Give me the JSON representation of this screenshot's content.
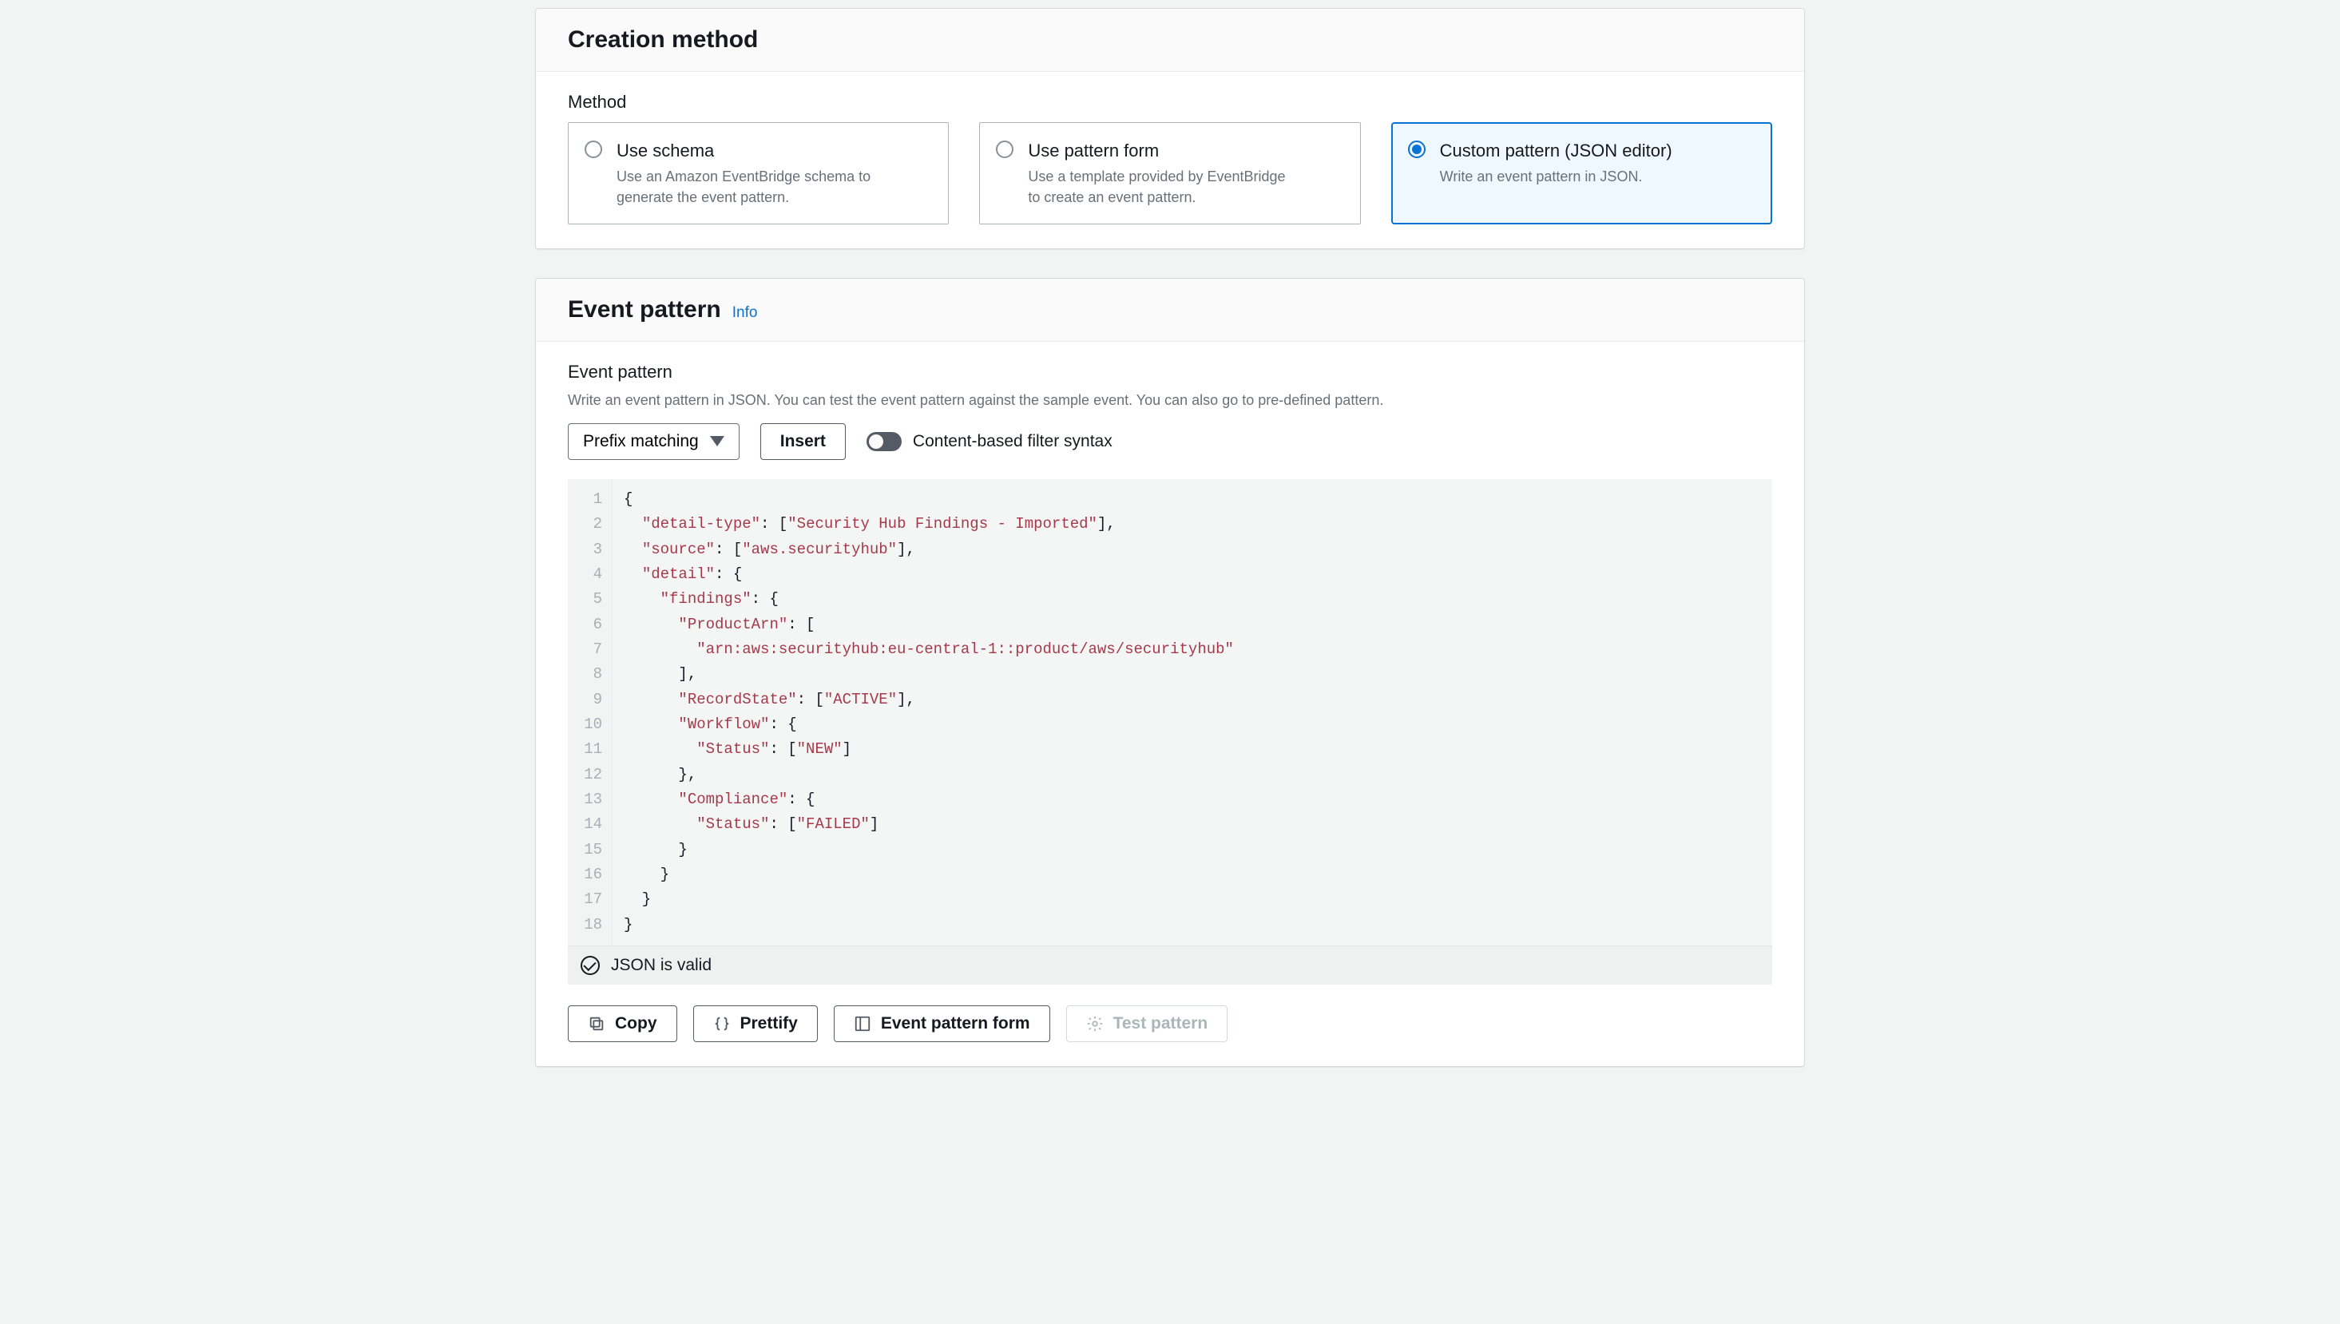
{
  "creation": {
    "title": "Creation method",
    "method_label": "Method",
    "options": [
      {
        "title": "Use schema",
        "desc": "Use an Amazon EventBridge schema to generate the event pattern."
      },
      {
        "title": "Use pattern form",
        "desc": "Use a template provided by EventBridge to create an event pattern."
      },
      {
        "title": "Custom pattern (JSON editor)",
        "desc": "Write an event pattern in JSON."
      }
    ]
  },
  "event_pattern": {
    "title": "Event pattern",
    "info": "Info",
    "label": "Event pattern",
    "desc": "Write an event pattern in JSON. You can test the event pattern against the sample event. You can also go to pre-defined pattern.",
    "select_value": "Prefix matching",
    "insert_label": "Insert",
    "toggle_label": "Content-based filter syntax",
    "status_text": "JSON is valid",
    "buttons": {
      "copy": "Copy",
      "prettify": "Prettify",
      "form": "Event pattern form",
      "test": "Test pattern"
    },
    "code_lines": [
      [
        {
          "t": "p",
          "v": "{"
        }
      ],
      [
        {
          "t": "p",
          "v": "  "
        },
        {
          "t": "k",
          "v": "\"detail-type\""
        },
        {
          "t": "p",
          "v": ": ["
        },
        {
          "t": "s",
          "v": "\"Security Hub Findings - Imported\""
        },
        {
          "t": "p",
          "v": "],"
        }
      ],
      [
        {
          "t": "p",
          "v": "  "
        },
        {
          "t": "k",
          "v": "\"source\""
        },
        {
          "t": "p",
          "v": ": ["
        },
        {
          "t": "s",
          "v": "\"aws.securityhub\""
        },
        {
          "t": "p",
          "v": "],"
        }
      ],
      [
        {
          "t": "p",
          "v": "  "
        },
        {
          "t": "k",
          "v": "\"detail\""
        },
        {
          "t": "p",
          "v": ": {"
        }
      ],
      [
        {
          "t": "p",
          "v": "    "
        },
        {
          "t": "k",
          "v": "\"findings\""
        },
        {
          "t": "p",
          "v": ": {"
        }
      ],
      [
        {
          "t": "p",
          "v": "      "
        },
        {
          "t": "k",
          "v": "\"ProductArn\""
        },
        {
          "t": "p",
          "v": ": ["
        }
      ],
      [
        {
          "t": "p",
          "v": "        "
        },
        {
          "t": "s",
          "v": "\"arn:aws:securityhub:eu-central-1::product/aws/securityhub\""
        }
      ],
      [
        {
          "t": "p",
          "v": "      ],"
        }
      ],
      [
        {
          "t": "p",
          "v": "      "
        },
        {
          "t": "k",
          "v": "\"RecordState\""
        },
        {
          "t": "p",
          "v": ": ["
        },
        {
          "t": "s",
          "v": "\"ACTIVE\""
        },
        {
          "t": "p",
          "v": "],"
        }
      ],
      [
        {
          "t": "p",
          "v": "      "
        },
        {
          "t": "k",
          "v": "\"Workflow\""
        },
        {
          "t": "p",
          "v": ": {"
        }
      ],
      [
        {
          "t": "p",
          "v": "        "
        },
        {
          "t": "k",
          "v": "\"Status\""
        },
        {
          "t": "p",
          "v": ": ["
        },
        {
          "t": "s",
          "v": "\"NEW\""
        },
        {
          "t": "p",
          "v": "]"
        }
      ],
      [
        {
          "t": "p",
          "v": "      },"
        }
      ],
      [
        {
          "t": "p",
          "v": "      "
        },
        {
          "t": "k",
          "v": "\"Compliance\""
        },
        {
          "t": "p",
          "v": ": {"
        }
      ],
      [
        {
          "t": "p",
          "v": "        "
        },
        {
          "t": "k",
          "v": "\"Status\""
        },
        {
          "t": "p",
          "v": ": ["
        },
        {
          "t": "s",
          "v": "\"FAILED\""
        },
        {
          "t": "p",
          "v": "]"
        }
      ],
      [
        {
          "t": "p",
          "v": "      }"
        }
      ],
      [
        {
          "t": "p",
          "v": "    }"
        }
      ],
      [
        {
          "t": "p",
          "v": "  }"
        }
      ],
      [
        {
          "t": "p",
          "v": "}"
        }
      ]
    ]
  }
}
